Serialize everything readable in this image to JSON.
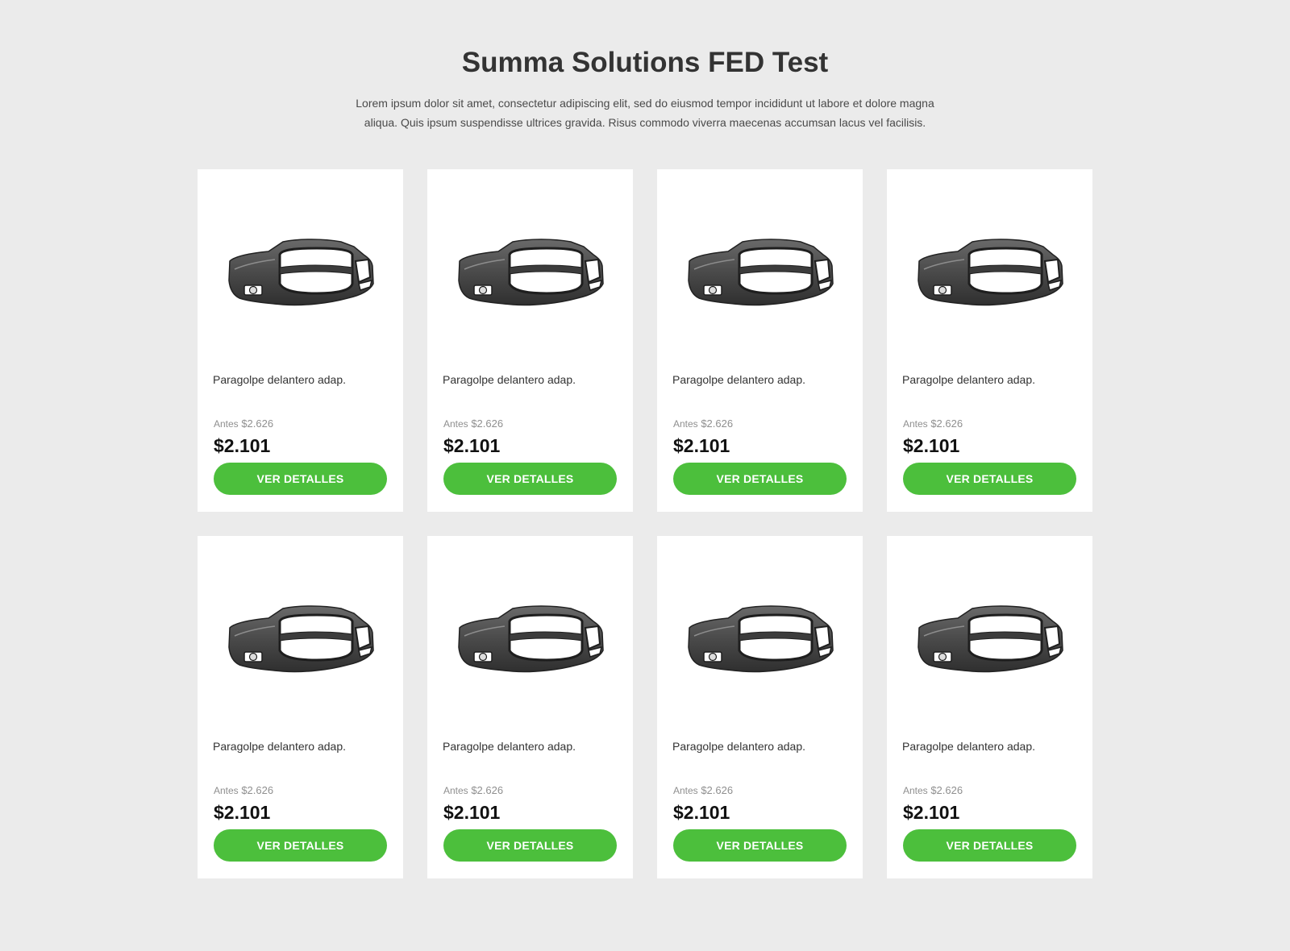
{
  "header": {
    "title": "Summa Solutions FED Test",
    "description": "Lorem ipsum dolor sit amet, consectetur adipiscing elit, sed do eiusmod tempor incididunt ut labore et dolore magna aliqua. Quis ipsum suspendisse ultrices gravida. Risus commodo viverra maecenas accumsan lacus vel facilisis."
  },
  "theme": {
    "background": "#ebebeb",
    "card_background": "#ffffff",
    "button_color": "#4cbf3c",
    "button_text_color": "#ffffff"
  },
  "products": [
    {
      "image_icon": "car-bumper-image",
      "name": "Paragolpe delantero adap.",
      "old_price_prefix": "Antes",
      "old_price": "$2.626",
      "price": "$2.101",
      "button_label": "VER DETALLES"
    },
    {
      "image_icon": "car-bumper-image",
      "name": "Paragolpe delantero adap.",
      "old_price_prefix": "Antes",
      "old_price": "$2.626",
      "price": "$2.101",
      "button_label": "VER DETALLES"
    },
    {
      "image_icon": "car-bumper-image",
      "name": "Paragolpe delantero adap.",
      "old_price_prefix": "Antes",
      "old_price": "$2.626",
      "price": "$2.101",
      "button_label": "VER DETALLES"
    },
    {
      "image_icon": "car-bumper-image",
      "name": "Paragolpe delantero adap.",
      "old_price_prefix": "Antes",
      "old_price": "$2.626",
      "price": "$2.101",
      "button_label": "VER DETALLES"
    },
    {
      "image_icon": "car-bumper-image",
      "name": "Paragolpe delantero adap.",
      "old_price_prefix": "Antes",
      "old_price": "$2.626",
      "price": "$2.101",
      "button_label": "VER DETALLES"
    },
    {
      "image_icon": "car-bumper-image",
      "name": "Paragolpe delantero adap.",
      "old_price_prefix": "Antes",
      "old_price": "$2.626",
      "price": "$2.101",
      "button_label": "VER DETALLES"
    },
    {
      "image_icon": "car-bumper-image",
      "name": "Paragolpe delantero adap.",
      "old_price_prefix": "Antes",
      "old_price": "$2.626",
      "price": "$2.101",
      "button_label": "VER DETALLES"
    },
    {
      "image_icon": "car-bumper-image",
      "name": "Paragolpe delantero adap.",
      "old_price_prefix": "Antes",
      "old_price": "$2.626",
      "price": "$2.101",
      "button_label": "VER DETALLES"
    }
  ]
}
